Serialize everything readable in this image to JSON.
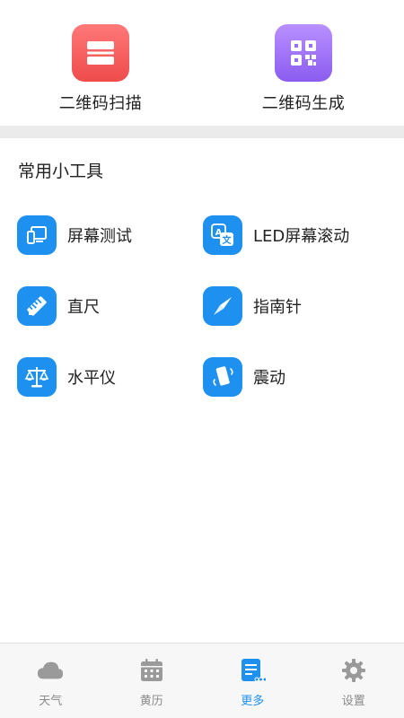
{
  "top_actions": {
    "scan": {
      "label": "二维码扫描",
      "icon": "scan-icon",
      "color": "#f25a5a"
    },
    "generate": {
      "label": "二维码生成",
      "icon": "qr-code-icon",
      "color": "#9b6cf5"
    }
  },
  "section": {
    "title": "常用小工具"
  },
  "tools": [
    {
      "label": "屏幕测试",
      "icon": "screen-test-icon"
    },
    {
      "label": "LED屏幕滚动",
      "icon": "translate-icon"
    },
    {
      "label": "直尺",
      "icon": "ruler-icon"
    },
    {
      "label": "指南针",
      "icon": "compass-icon"
    },
    {
      "label": "水平仪",
      "icon": "balance-scale-icon"
    },
    {
      "label": "震动",
      "icon": "vibrate-phone-icon"
    }
  ],
  "tabbar": {
    "tabs": [
      {
        "label": "天气",
        "icon": "cloud-icon",
        "active": false
      },
      {
        "label": "黄历",
        "icon": "calendar-icon",
        "active": false
      },
      {
        "label": "更多",
        "icon": "more-list-icon",
        "active": true
      },
      {
        "label": "设置",
        "icon": "gear-icon",
        "active": false
      }
    ]
  },
  "colors": {
    "accent": "#1e90f0",
    "inactive": "#8a8a8a",
    "tab_bg": "#f7f7f7",
    "band": "#ebebeb"
  }
}
